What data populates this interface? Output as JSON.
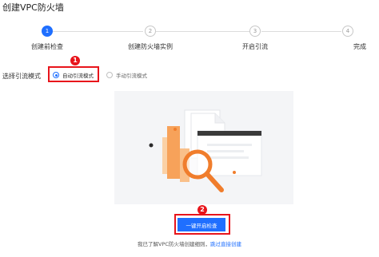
{
  "page": {
    "title": "创建VPC防火墙"
  },
  "steps": [
    {
      "number": "1",
      "label": "创建前检查",
      "active": true
    },
    {
      "number": "2",
      "label": "创建防火墙实例",
      "active": false
    },
    {
      "number": "3",
      "label": "开启引流",
      "active": false
    },
    {
      "number": "4",
      "label": "完成",
      "active": false
    }
  ],
  "mode": {
    "label": "选择引流模式",
    "options": [
      {
        "label": "自动引流模式",
        "selected": true
      },
      {
        "label": "手动引流模式",
        "selected": false
      }
    ]
  },
  "annotations": {
    "badge1": "1",
    "badge2": "2"
  },
  "actions": {
    "primary_label": "一键开启检查"
  },
  "footer": {
    "text": "我已了解VPC防火墙创建细则，",
    "link": "跳过直接创建"
  },
  "colors": {
    "accent": "#1f6fff",
    "annotation": "#e8141b",
    "illustration_orange": "#f7a25a"
  }
}
